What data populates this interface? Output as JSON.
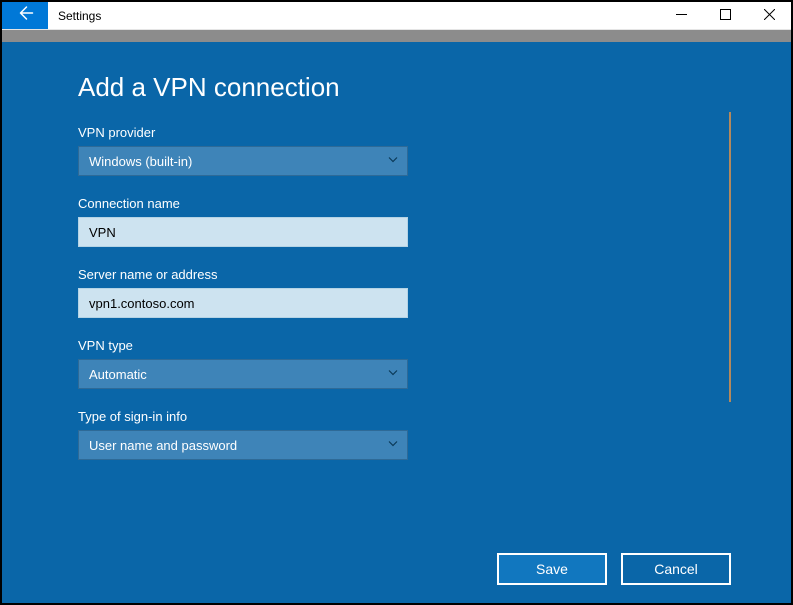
{
  "window": {
    "title": "Settings"
  },
  "page": {
    "title": "Add a VPN connection"
  },
  "fields": {
    "vpn_provider": {
      "label": "VPN provider",
      "value": "Windows (built-in)"
    },
    "connection_name": {
      "label": "Connection name",
      "value": "VPN"
    },
    "server_address": {
      "label": "Server name or address",
      "value": "vpn1.contoso.com"
    },
    "vpn_type": {
      "label": "VPN type",
      "value": "Automatic"
    },
    "sign_in_type": {
      "label": "Type of sign-in info",
      "value": "User name and password"
    }
  },
  "buttons": {
    "save": "Save",
    "cancel": "Cancel"
  }
}
